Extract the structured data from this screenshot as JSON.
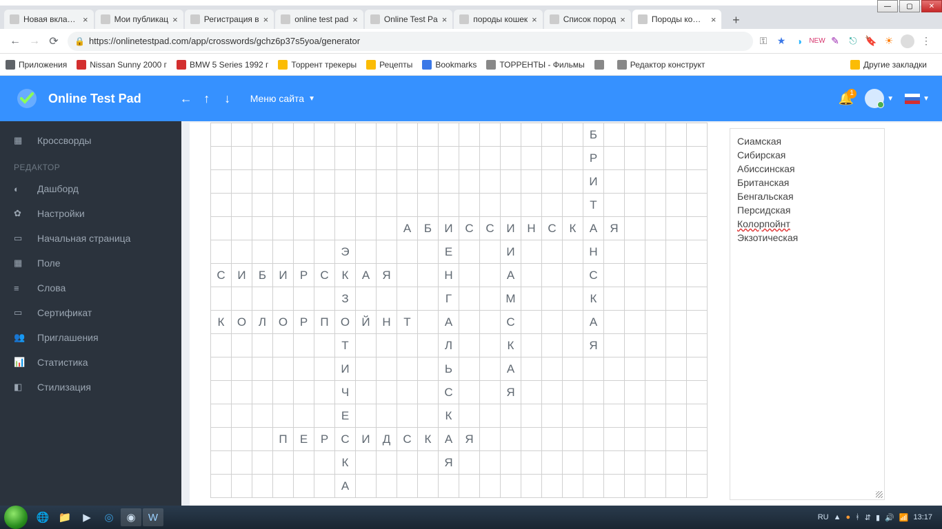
{
  "window": {
    "min": "—",
    "max": "▢",
    "close": "✕"
  },
  "tabs": [
    {
      "title": "Новая вкладка"
    },
    {
      "title": "Мои публикац"
    },
    {
      "title": "Регистрация в"
    },
    {
      "title": "online test pad"
    },
    {
      "title": "Online Test Pa"
    },
    {
      "title": "породы кошек"
    },
    {
      "title": "Список пород"
    },
    {
      "title": "Породы кошек"
    }
  ],
  "address": {
    "url": "https://onlinetestpad.com/app/crosswords/gchz6p37s5yoa/generator"
  },
  "bookmarks": [
    {
      "label": "Приложения"
    },
    {
      "label": "Nissan Sunny 2000 г"
    },
    {
      "label": "BMW 5 Series 1992 г"
    },
    {
      "label": "Торрент трекеры"
    },
    {
      "label": "Рецепты"
    },
    {
      "label": "Bookmarks"
    },
    {
      "label": "ТОРРЕНТЫ - Фильмы"
    },
    {
      "label": ""
    },
    {
      "label": "Редактор конструкт"
    }
  ],
  "bookmarks_right": {
    "label": "Другие закладки"
  },
  "app_header": {
    "title": "Online Test Pad",
    "menu": "Меню сайта",
    "notifications": "1"
  },
  "sidebar": {
    "items": [
      {
        "icon": "▦",
        "label": "Кроссворды"
      }
    ],
    "section": "РЕДАКТОР",
    "editor_items": [
      {
        "icon": "◐",
        "label": "Дашборд"
      },
      {
        "icon": "✿",
        "label": "Настройки"
      },
      {
        "icon": "▭",
        "label": "Начальная страница"
      },
      {
        "icon": "▦",
        "label": "Поле"
      },
      {
        "icon": "≡",
        "label": "Слова"
      },
      {
        "icon": "▭",
        "label": "Сертификат"
      },
      {
        "icon": "👥",
        "label": "Приглашения"
      },
      {
        "icon": "📊",
        "label": "Статистика"
      },
      {
        "icon": "◧",
        "label": "Стилизация"
      }
    ]
  },
  "crossword": {
    "rows": 16,
    "cols": 24,
    "entries": [
      {
        "r": 0,
        "c": 18,
        "text": "Б"
      },
      {
        "r": 1,
        "c": 18,
        "text": "Р"
      },
      {
        "r": 2,
        "c": 18,
        "text": "И"
      },
      {
        "r": 3,
        "c": 18,
        "text": "Т"
      },
      {
        "r": 4,
        "c": 9,
        "text": "А"
      },
      {
        "r": 4,
        "c": 10,
        "text": "Б"
      },
      {
        "r": 4,
        "c": 11,
        "text": "И"
      },
      {
        "r": 4,
        "c": 12,
        "text": "С"
      },
      {
        "r": 4,
        "c": 13,
        "text": "С"
      },
      {
        "r": 4,
        "c": 14,
        "text": "И"
      },
      {
        "r": 4,
        "c": 15,
        "text": "Н"
      },
      {
        "r": 4,
        "c": 16,
        "text": "С"
      },
      {
        "r": 4,
        "c": 17,
        "text": "К"
      },
      {
        "r": 4,
        "c": 18,
        "text": "А"
      },
      {
        "r": 4,
        "c": 19,
        "text": "Я"
      },
      {
        "r": 5,
        "c": 6,
        "text": "Э"
      },
      {
        "r": 5,
        "c": 11,
        "text": "Е"
      },
      {
        "r": 5,
        "c": 14,
        "text": "И"
      },
      {
        "r": 5,
        "c": 18,
        "text": "Н"
      },
      {
        "r": 6,
        "c": 0,
        "text": "С"
      },
      {
        "r": 6,
        "c": 1,
        "text": "И"
      },
      {
        "r": 6,
        "c": 2,
        "text": "Б"
      },
      {
        "r": 6,
        "c": 3,
        "text": "И"
      },
      {
        "r": 6,
        "c": 4,
        "text": "Р"
      },
      {
        "r": 6,
        "c": 5,
        "text": "С"
      },
      {
        "r": 6,
        "c": 6,
        "text": "К"
      },
      {
        "r": 6,
        "c": 7,
        "text": "А"
      },
      {
        "r": 6,
        "c": 8,
        "text": "Я"
      },
      {
        "r": 6,
        "c": 11,
        "text": "Н"
      },
      {
        "r": 6,
        "c": 14,
        "text": "А"
      },
      {
        "r": 6,
        "c": 18,
        "text": "С"
      },
      {
        "r": 7,
        "c": 6,
        "text": "З"
      },
      {
        "r": 7,
        "c": 11,
        "text": "Г"
      },
      {
        "r": 7,
        "c": 14,
        "text": "М"
      },
      {
        "r": 7,
        "c": 18,
        "text": "К"
      },
      {
        "r": 8,
        "c": 0,
        "text": "К"
      },
      {
        "r": 8,
        "c": 1,
        "text": "О"
      },
      {
        "r": 8,
        "c": 2,
        "text": "Л"
      },
      {
        "r": 8,
        "c": 3,
        "text": "О"
      },
      {
        "r": 8,
        "c": 4,
        "text": "Р"
      },
      {
        "r": 8,
        "c": 5,
        "text": "П"
      },
      {
        "r": 8,
        "c": 6,
        "text": "О"
      },
      {
        "r": 8,
        "c": 7,
        "text": "Й"
      },
      {
        "r": 8,
        "c": 8,
        "text": "Н"
      },
      {
        "r": 8,
        "c": 9,
        "text": "Т"
      },
      {
        "r": 8,
        "c": 11,
        "text": "А"
      },
      {
        "r": 8,
        "c": 14,
        "text": "С"
      },
      {
        "r": 8,
        "c": 18,
        "text": "А"
      },
      {
        "r": 9,
        "c": 6,
        "text": "Т"
      },
      {
        "r": 9,
        "c": 11,
        "text": "Л"
      },
      {
        "r": 9,
        "c": 14,
        "text": "К"
      },
      {
        "r": 9,
        "c": 18,
        "text": "Я"
      },
      {
        "r": 10,
        "c": 6,
        "text": "И"
      },
      {
        "r": 10,
        "c": 11,
        "text": "Ь"
      },
      {
        "r": 10,
        "c": 14,
        "text": "А"
      },
      {
        "r": 11,
        "c": 6,
        "text": "Ч"
      },
      {
        "r": 11,
        "c": 11,
        "text": "С"
      },
      {
        "r": 11,
        "c": 14,
        "text": "Я"
      },
      {
        "r": 12,
        "c": 6,
        "text": "Е"
      },
      {
        "r": 12,
        "c": 11,
        "text": "К"
      },
      {
        "r": 13,
        "c": 3,
        "text": "П"
      },
      {
        "r": 13,
        "c": 4,
        "text": "Е"
      },
      {
        "r": 13,
        "c": 5,
        "text": "Р"
      },
      {
        "r": 13,
        "c": 6,
        "text": "С"
      },
      {
        "r": 13,
        "c": 7,
        "text": "И"
      },
      {
        "r": 13,
        "c": 8,
        "text": "Д"
      },
      {
        "r": 13,
        "c": 9,
        "text": "С"
      },
      {
        "r": 13,
        "c": 10,
        "text": "К"
      },
      {
        "r": 13,
        "c": 11,
        "text": "А"
      },
      {
        "r": 13,
        "c": 12,
        "text": "Я"
      },
      {
        "r": 14,
        "c": 6,
        "text": "К"
      },
      {
        "r": 14,
        "c": 11,
        "text": "Я"
      },
      {
        "r": 15,
        "c": 6,
        "text": "А"
      }
    ]
  },
  "wordlist": [
    {
      "text": "Сиамская"
    },
    {
      "text": "Сибирская"
    },
    {
      "text": "Абиссинская"
    },
    {
      "text": "Британская"
    },
    {
      "text": "Бенгальская"
    },
    {
      "text": "Персидская"
    },
    {
      "text": "Колорпойнт",
      "underline": true
    },
    {
      "text": "Экзотическая"
    }
  ],
  "tray": {
    "lang": "RU",
    "time": "13:17"
  }
}
